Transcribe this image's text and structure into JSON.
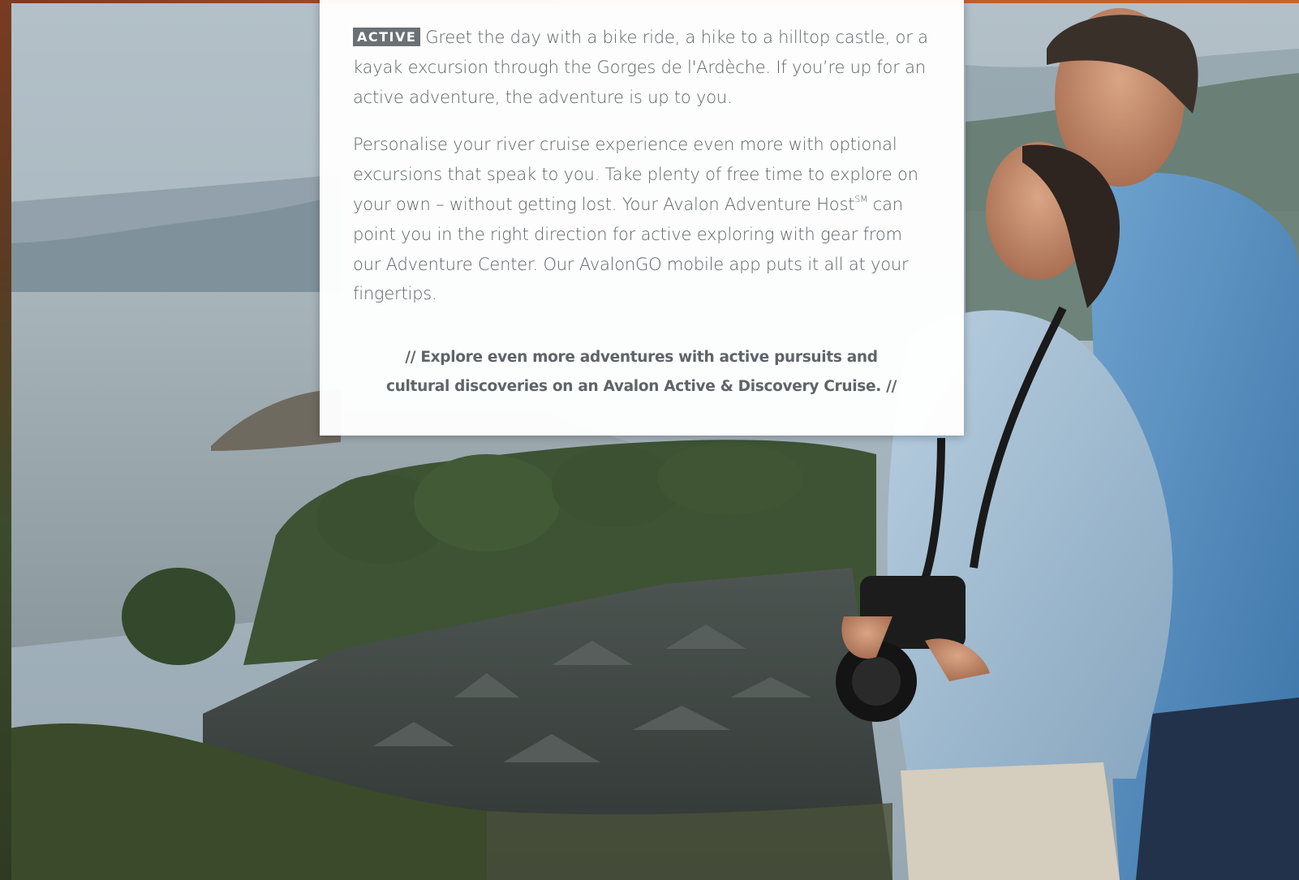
{
  "card": {
    "tag": "ACTIVE",
    "para1": "Greet the day with a bike ride, a hike to a hilltop castle, or a kayak excursion through the Gorges de l'Ardèche. If you’re up for an active adventure, the adventure is up to you.",
    "para2_part1": "Personalise your river cruise experience even more with optional excursions that speak to you. Take plenty of free time to explore on your own – without getting lost. Your Avalon Adventure Host",
    "para2_mark": "SM",
    "para2_part2": " can point you in the right direction for active exploring with gear from our Adventure Center. Our AvalonGO mobile app puts it all at your fingertips.",
    "callout": "// Explore even more adventures with active pursuits and cultural discoveries on an Avalon Active & Discovery Cruise. //"
  },
  "colors": {
    "text": "#5e6468",
    "tag_bg": "#6b7074",
    "card_bg": "#ffffff"
  }
}
